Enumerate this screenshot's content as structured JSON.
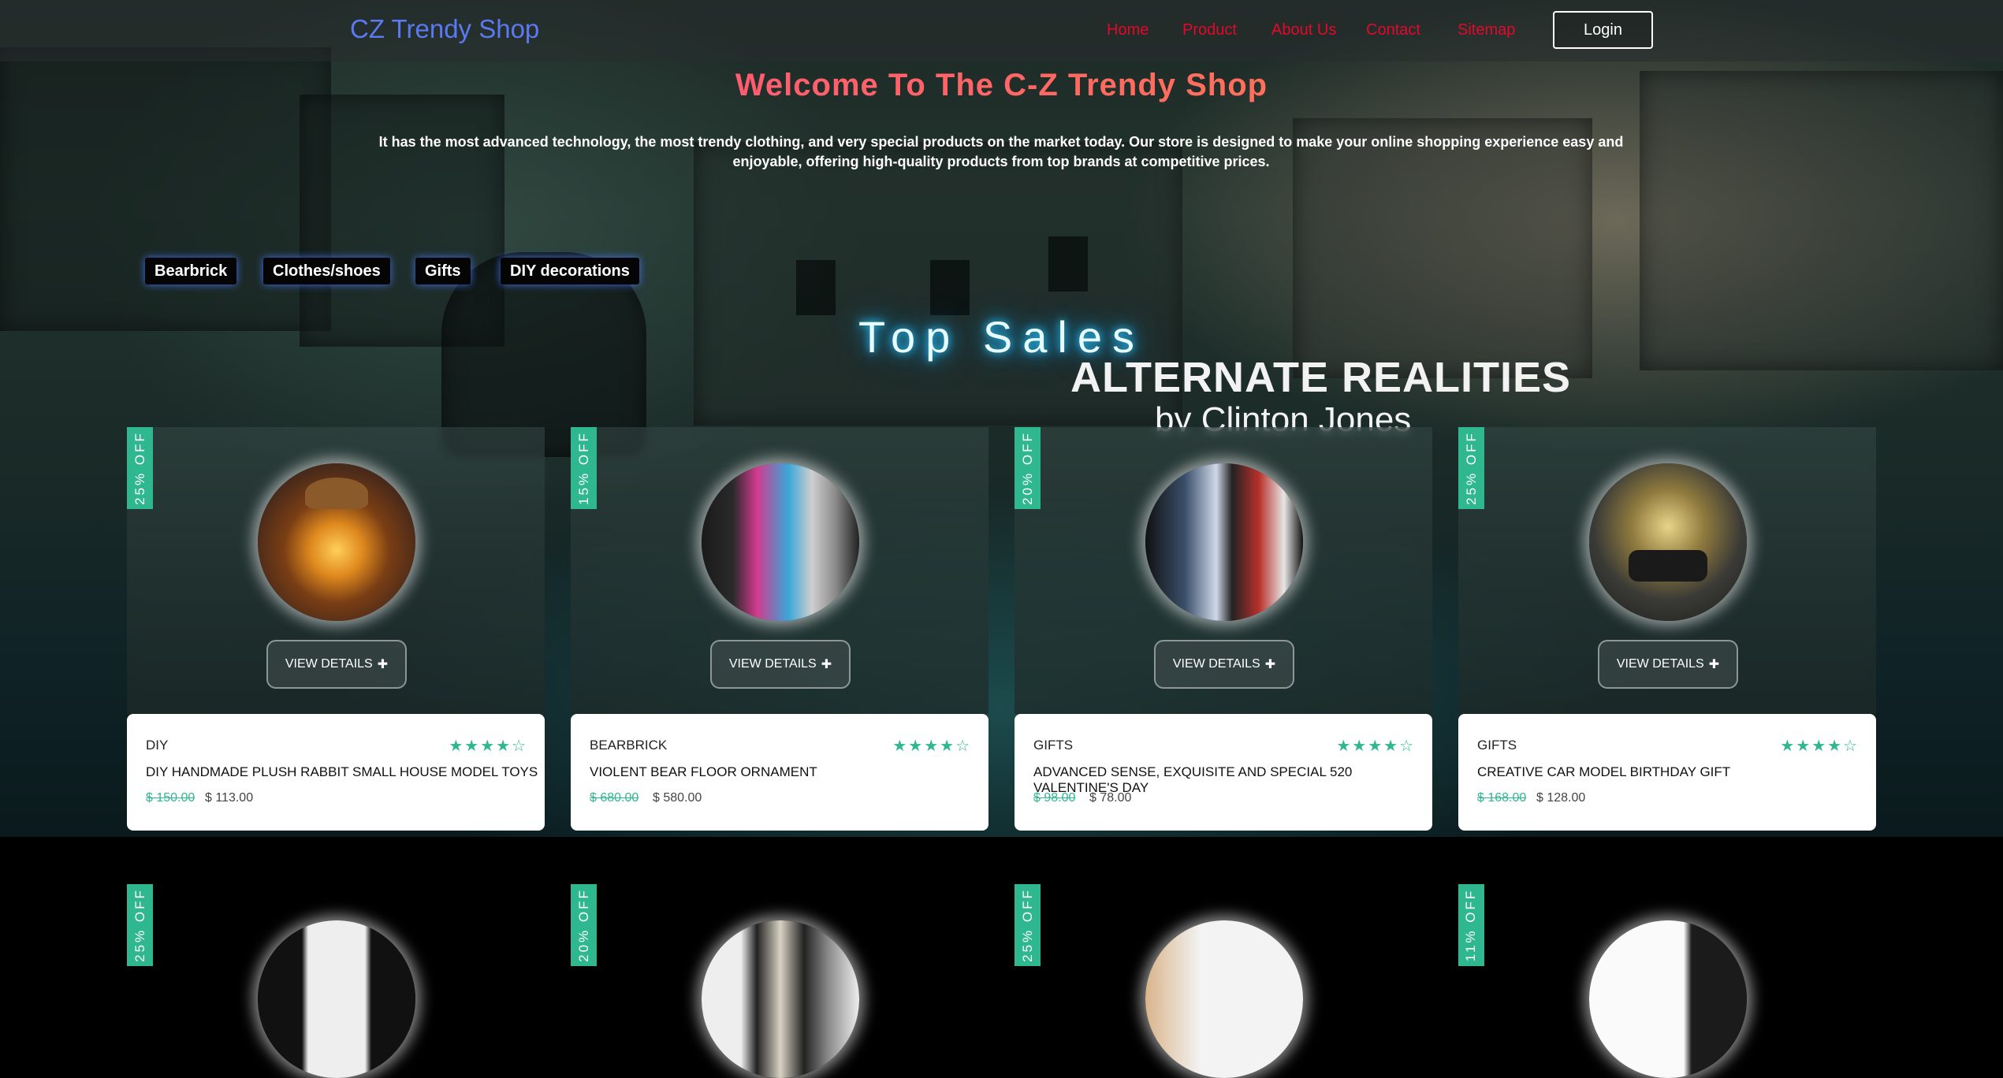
{
  "header": {
    "brand": "CZ Trendy Shop",
    "nav": [
      "Home",
      "Product",
      "About Us",
      "Contact",
      "Sitemap"
    ],
    "login_label": "Login"
  },
  "hero": {
    "title": "Welcome To The C-Z Trendy Shop",
    "description": "It has the most advanced technology, the most trendy clothing, and very special products on the market today. Our store is designed to make your online shopping experience easy and enjoyable, offering high-quality products from top brands at competitive prices.",
    "background_title": "ALTERNATE REALITIES",
    "background_subtitle": "by Clinton Jones"
  },
  "categories": [
    "Bearbrick",
    "Clothes/shoes",
    "Gifts",
    "DIY decorations"
  ],
  "section_title": "Top Sales",
  "view_details_label": "VIEW DETAILS",
  "colors": {
    "accent": "#2fb78f",
    "nav_link": "#e4082b",
    "brand": "#5b79f0"
  },
  "products": [
    {
      "discount": "25% OFF",
      "category": "DIY",
      "title": "DIY HANDMADE PLUSH RABBIT SMALL HOUSE MODEL TOYS",
      "old_price": "$ 150.00",
      "new_price": "$ 113.00",
      "rating": 4
    },
    {
      "discount": "15% OFF",
      "category": "BEARBRICK",
      "title": "VIOLENT BEAR FLOOR ORNAMENT",
      "old_price": "$ 680.00",
      "new_price": "$ 580.00",
      "rating": 4
    },
    {
      "discount": "20% OFF",
      "category": "GIFTS",
      "title": "ADVANCED SENSE, EXQUISITE AND SPECIAL 520 VALENTINE'S DAY",
      "old_price": "$ 98.00",
      "new_price": "$ 78.00",
      "rating": 4
    },
    {
      "discount": "25% OFF",
      "category": "GIFTS",
      "title": "CREATIVE CAR MODEL BIRTHDAY GIFT",
      "old_price": "$ 168.00",
      "new_price": "$ 128.00",
      "rating": 4
    }
  ],
  "products_row2": [
    {
      "discount": "25% OFF"
    },
    {
      "discount": "20% OFF"
    },
    {
      "discount": "25% OFF"
    },
    {
      "discount": "11% OFF"
    }
  ]
}
